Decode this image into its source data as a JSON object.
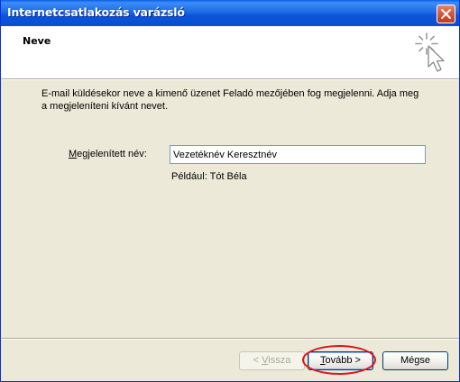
{
  "window": {
    "title": "Internetcsatlakozás varázsló",
    "close_icon": "close-icon"
  },
  "header": {
    "title": "Neve",
    "icon": "wizard-sparkle-cursor-icon"
  },
  "content": {
    "description": "E-mail küldésekor neve a kimenő üzenet Feladó mezőjében fog megjelenni. Adja meg a megjeleníteni kívánt nevet.",
    "field_label_accel": "M",
    "field_label_rest": "egjelenített név:",
    "name_value": "Vezetéknév Keresztnév",
    "example": "Például: Tót Béla"
  },
  "buttons": {
    "back_prefix": "< ",
    "back_accel": "V",
    "back_rest": "issza",
    "next_accel": "T",
    "next_rest": "ovább >",
    "cancel": "Mégse"
  },
  "colors": {
    "titlebar": "#0a5ee8",
    "dialog_bg": "#ece9d8",
    "highlight": "#e0131d"
  }
}
